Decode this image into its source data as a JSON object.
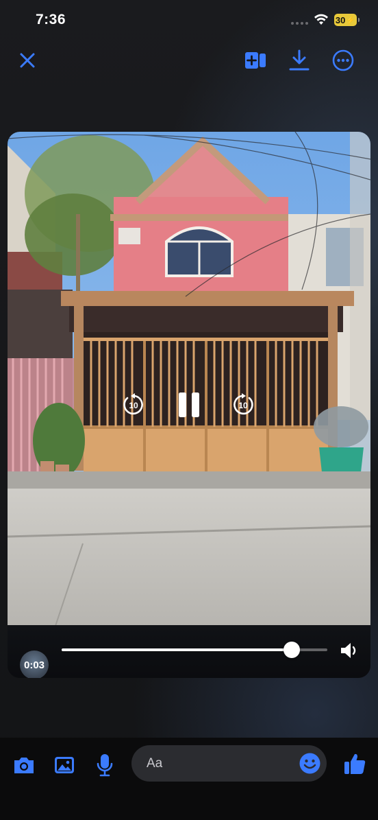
{
  "status_bar": {
    "time": "7:36",
    "battery": "30"
  },
  "toolbar": {
    "close_icon": "close-icon",
    "add_icon": "add-to-story-icon",
    "download_icon": "download-icon",
    "more_icon": "more-options-icon"
  },
  "video": {
    "current_time": "0:03",
    "progress": 0.866,
    "skip_back_seconds": "10",
    "skip_forward_seconds": "10"
  },
  "composer": {
    "placeholder": "Aa"
  },
  "colors": {
    "accent": "#3b7bff",
    "background": "#141416",
    "battery": "#e8c93a"
  }
}
